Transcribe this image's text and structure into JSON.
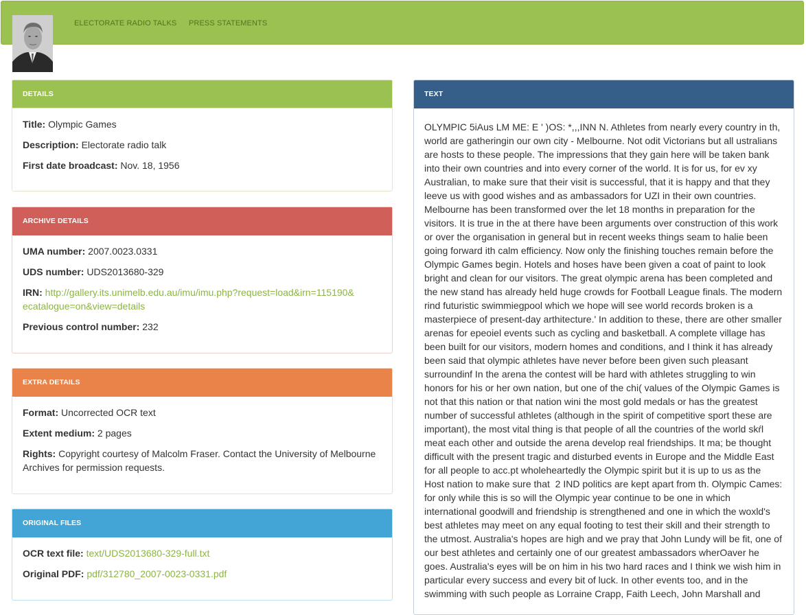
{
  "nav": {
    "links": [
      "ELECTORATE RADIO TALKS",
      "PRESS STATEMENTS"
    ]
  },
  "details": {
    "heading": "DETAILS",
    "title_label": "Title:",
    "title_value": "Olympic Games",
    "description_label": "Description:",
    "description_value": "Electorate radio talk",
    "date_label": "First date broadcast:",
    "date_value": "Nov. 18, 1956"
  },
  "archive": {
    "heading": "ARCHIVE DETAILS",
    "uma_label": "UMA number:",
    "uma_value": "2007.0023.0331",
    "uds_label": "UDS number:",
    "uds_value": "UDS2013680-329",
    "irn_label": "IRN:",
    "irn_value_line1": "http://gallery.its.unimelb.edu.au/imu/imu.php?request=load&irn=115190&",
    "irn_value_line2": "ecatalogue=on&view=details",
    "prev_label": "Previous control number:",
    "prev_value": "232"
  },
  "extra": {
    "heading": "EXTRA DETAILS",
    "format_label": "Format:",
    "format_value": "Uncorrected OCR text",
    "extent_label": "Extent medium:",
    "extent_value": "2 pages",
    "rights_label": "Rights:",
    "rights_value": "Copyright courtesy of Malcolm Fraser. Contact the University of Melbourne Archives for permission requests."
  },
  "files": {
    "heading": "ORIGINAL FILES",
    "ocr_label": "OCR text file:",
    "ocr_value": "text/UDS2013680-329-full.txt",
    "pdf_label": "Original PDF:",
    "pdf_value": "pdf/312780_2007-0023-0331.pdf"
  },
  "text": {
    "heading": "TEXT",
    "lines": [
      "OLYMPIC 5iAus LM ME: E ' )OS: *,,,INN N. Athletes from nearly every country in th,",
      "world are gatheringin our own city - Melbourne. Not odit Victorians but all ustralians",
      "are hosts to these people. The impressions that they gain here will be taken bank",
      "into their own countries and into every corner of the world. It is for us, for ev xy",
      "Australian, to make sure that their visit is successful, that it is happy and that they",
      "leeve us with good wishes and as ambassadors for UZI in their own countries.",
      "Melbourne has been transformed over the let 18 months in preparation for the",
      "visitors. It is true in the at there have been arguments over construction of this work",
      "or over the organisation in general but in recent weeks things seam to halie been",
      "going forward ith calm efficiency. Now only the finishing touches remain before the",
      "Olympic Games begin. Hotels and hoses have been given a coat of paint to look",
      "bright and clean for our visitors. The great olympic arena has been completed and",
      "the new stand has already held huge crowds for Football League finals. The modern",
      "rind futuristic swimmiegpool which we hope will see world records broken is a",
      "masterpiece of present-day arthitecture.' In addition to these, there are other smaller",
      "arenas for epeoiel events such as cycling and basketball. A complete village has",
      "been built for our visitors, modern homes and conditions, and I think it has already",
      "been said that olympic athletes have never before been given such pleasant",
      "surroundinf In the arena the contest will be hard with athletes struggling to win",
      "honors for his or her own nation, but one of the chi( values of the Olympic Games is",
      "not that this nation or that nation wini the most gold medals or has the greatest",
      "number of successful athletes (although in the spirit of competitive sport these are",
      "important), the most vital thing is that people of all the countries of the world skŕl",
      "meat each other and outside the arena develop real friendships. It ma; be thought",
      "difficult with the present tragic and disturbed events in Europe and the Middle East",
      "for all people to acc.pt wholeheartedly the Olympic spirit but it is up to us as the",
      "Host nation to make sure that  2 IND politics are kept apart from th. Olympic Cames:",
      "for only while this is so will the Olympic year continue to be one in which",
      "international goodwill and friendship is strengthened and one in which the woxld's",
      "best athletes may meet on any equal footing to test their skill and their strength to",
      "the utmost. Australia's hopes are high and we pray that John Lundy will be fit, one of",
      "our best athletes and certainly one of our greatest ambassadors wherOaver he",
      "goes. Australia's eyes will be on him in his two hard races and I think we wish him in",
      "particular every success and every bit of luck. In other events too, and in the",
      "swimming with such people as Lorraine Crapp, Faith Leech, John Marshall and"
    ]
  },
  "colors": {
    "green": "#9bc151",
    "red": "#d05f59",
    "orange": "#ea834a",
    "blue": "#42a5d6",
    "navy": "#355f88",
    "link": "#8cb544"
  }
}
